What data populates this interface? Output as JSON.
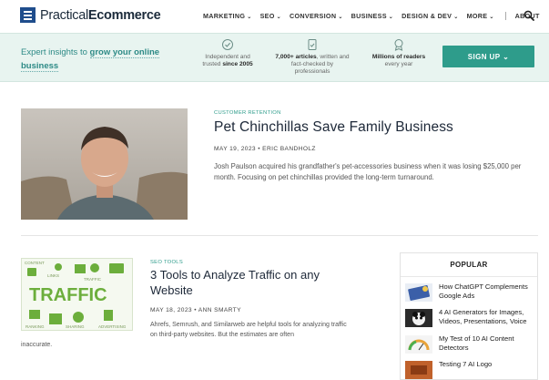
{
  "brand": {
    "name_part1": "Practical",
    "name_part2": "Ecommerce"
  },
  "nav": {
    "items": [
      {
        "label": "MARKETING"
      },
      {
        "label": "SEO"
      },
      {
        "label": "CONVERSION"
      },
      {
        "label": "BUSINESS"
      },
      {
        "label": "DESIGN & DEV"
      },
      {
        "label": "MORE"
      }
    ],
    "about": "ABOUT",
    "search_icon": "search-icon"
  },
  "banner": {
    "lead_plain": "Expert insights to ",
    "lead_bold": "grow your online business",
    "features": [
      {
        "icon": "check-badge-icon",
        "line1": "Independent and",
        "line2": "trusted ",
        "line2_bold": "since 2005"
      },
      {
        "icon": "document-check-icon",
        "line1_bold": "7,000+ articles",
        "line1_rest": ", written and",
        "line2": "fact-checked by",
        "line3": "professionals"
      },
      {
        "icon": "award-icon",
        "line1_bold": "Millions of readers",
        "line2": "every year"
      }
    ],
    "signup": "SIGN UP"
  },
  "featured": {
    "category": "CUSTOMER RETENTION",
    "title": "Pet Chinchillas Save Family Business",
    "meta": "MAY 19, 2023 • ERIC BANDHOLZ",
    "excerpt": "Josh Paulson acquired his grandfather's pet-accessories business when it was losing $25,000 per month. Focusing on pet chinchillas provided the long-term turnaround."
  },
  "second": {
    "category": "SEO TOOLS",
    "title": "3 Tools to Analyze Traffic on any Website",
    "meta": "MAY 18, 2023 • ANN SMARTY",
    "excerpt": "Ahrefs, Semrush, and Similarweb are helpful tools for analyzing traffic on third-party websites. But the estimates are often",
    "excerpt_tail": "inaccurate.",
    "image_word": "TRAFFIC",
    "image_tags": [
      "CONTENT",
      "LINKS",
      "TRAFFIC",
      "RANKING",
      "SHARING",
      "ADVERTISING"
    ]
  },
  "popular": {
    "heading": "POPULAR",
    "items": [
      {
        "title": "How ChatGPT Complements Google Ads"
      },
      {
        "title": "4 AI Generators for Images, Videos, Presentations, Voice"
      },
      {
        "title": "My Test of 10 AI Content Detectors"
      },
      {
        "title": "Testing 7 AI Logo"
      }
    ]
  },
  "colors": {
    "accent": "#2e9c8b",
    "brand": "#1f4d8c",
    "banner_bg": "#e8f4f0"
  }
}
